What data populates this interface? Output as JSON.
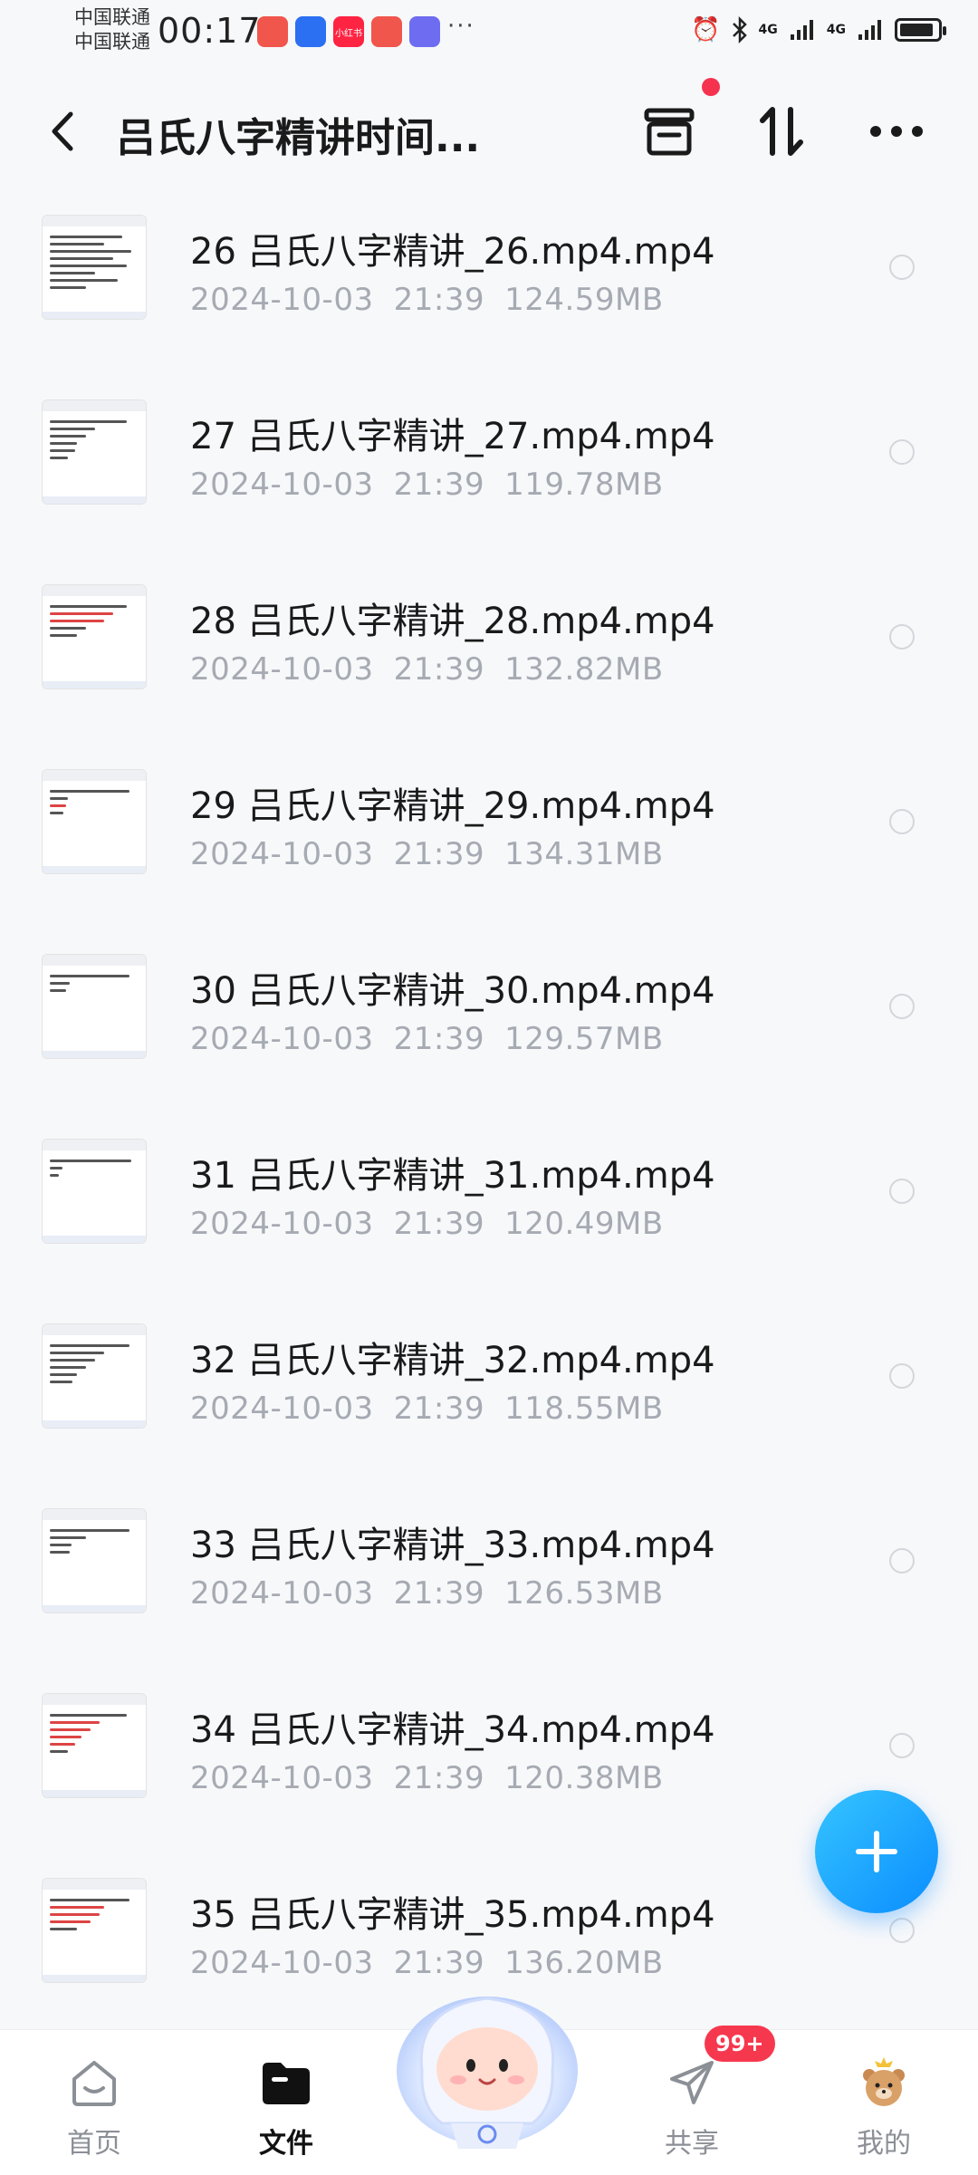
{
  "status_bar": {
    "carrier_1": "中国联通",
    "carrier_2": "中国联通",
    "time": "00:17",
    "app_badges": [
      {
        "name": "app-icon-1",
        "color": "#f0564c",
        "label": ""
      },
      {
        "name": "app-icon-2",
        "color": "#2b6ff3",
        "label": ""
      },
      {
        "name": "app-icon-3",
        "color": "#ff2442",
        "label": "小红书"
      },
      {
        "name": "app-icon-4",
        "color": "#f0564c",
        "label": ""
      },
      {
        "name": "app-icon-5",
        "color": "#6e6cf0",
        "label": ""
      }
    ],
    "more": "···",
    "network": "4G",
    "battery_level": 0.9
  },
  "header": {
    "title": "吕氏八字精讲时间...",
    "has_notification_dot": true
  },
  "files": [
    {
      "name": "26 吕氏八字精讲_26.mp4.mp4",
      "date": "2024-10-03",
      "time": "21:39",
      "size": "124.59MB"
    },
    {
      "name": "27 吕氏八字精讲_27.mp4.mp4",
      "date": "2024-10-03",
      "time": "21:39",
      "size": "119.78MB"
    },
    {
      "name": "28 吕氏八字精讲_28.mp4.mp4",
      "date": "2024-10-03",
      "time": "21:39",
      "size": "132.82MB"
    },
    {
      "name": "29 吕氏八字精讲_29.mp4.mp4",
      "date": "2024-10-03",
      "time": "21:39",
      "size": "134.31MB"
    },
    {
      "name": "30 吕氏八字精讲_30.mp4.mp4",
      "date": "2024-10-03",
      "time": "21:39",
      "size": "129.57MB"
    },
    {
      "name": "31 吕氏八字精讲_31.mp4.mp4",
      "date": "2024-10-03",
      "time": "21:39",
      "size": "120.49MB"
    },
    {
      "name": "32 吕氏八字精讲_32.mp4.mp4",
      "date": "2024-10-03",
      "time": "21:39",
      "size": "118.55MB"
    },
    {
      "name": "33 吕氏八字精讲_33.mp4.mp4",
      "date": "2024-10-03",
      "time": "21:39",
      "size": "126.53MB"
    },
    {
      "name": "34 吕氏八字精讲_34.mp4.mp4",
      "date": "2024-10-03",
      "time": "21:39",
      "size": "120.38MB"
    },
    {
      "name": "35 吕氏八字精讲_35.mp4.mp4",
      "date": "2024-10-03",
      "time": "21:39",
      "size": "136.20MB"
    }
  ],
  "bottom_nav": {
    "items": [
      {
        "label": "首页",
        "icon": "home-icon",
        "active": false
      },
      {
        "label": "文件",
        "icon": "folder-icon",
        "active": true
      },
      {
        "label": "共享",
        "icon": "send-icon",
        "active": false
      },
      {
        "label": "我的",
        "icon": "bear-avatar-icon",
        "active": false
      }
    ],
    "share_badge": "99+"
  },
  "colors": {
    "accent": "#0a8dff",
    "badge_red": "#f6384e",
    "meta_text": "#a6aab2"
  }
}
